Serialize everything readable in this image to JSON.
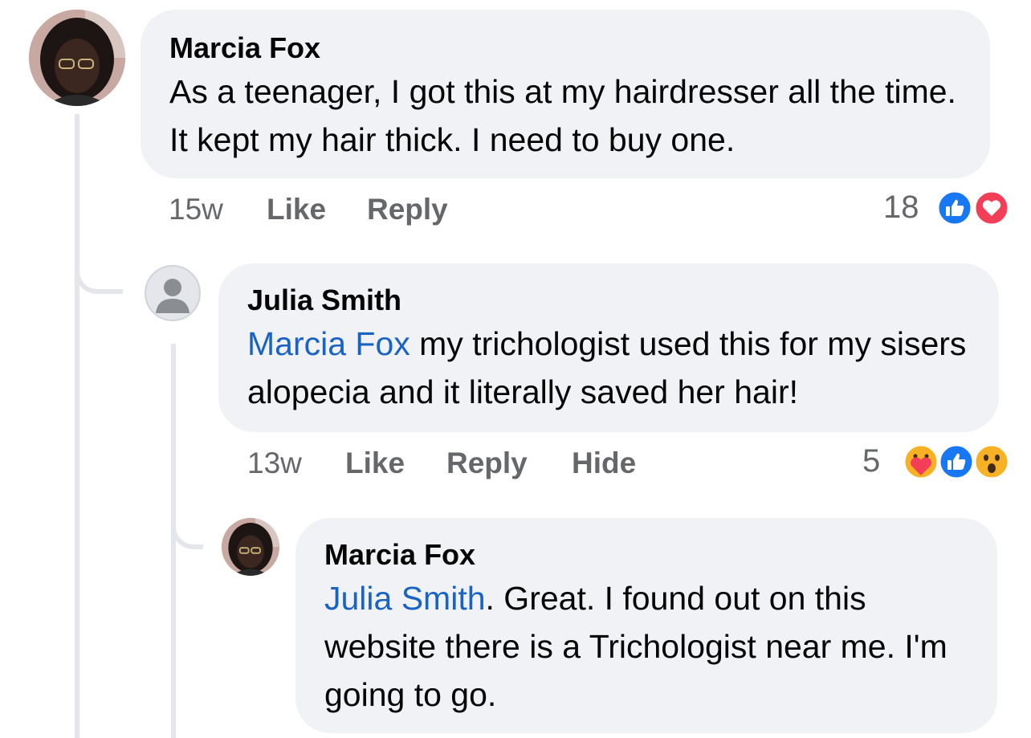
{
  "comments": [
    {
      "author": "Marcia Fox",
      "text": "As a teenager, I got this at my hairdresser all the time.  It kept my hair thick.  I need to buy one.",
      "time": "15w",
      "like_label": "Like",
      "reply_label": "Reply",
      "reaction_count": "18",
      "reactions": [
        "like-icon",
        "love-icon"
      ]
    },
    {
      "author": "Julia Smith",
      "mention": "Marcia Fox",
      "text": " my trichologist used this for my sisers alopecia and it literally saved her hair!",
      "time": "13w",
      "like_label": "Like",
      "reply_label": "Reply",
      "hide_label": "Hide",
      "reaction_count": "5",
      "reactions": [
        "care-icon",
        "like-icon",
        "wow-icon"
      ]
    },
    {
      "author": "Marcia Fox",
      "mention": "Julia Smith",
      "text": ". Great.  I found out on this website there is a Trichologist near me. I'm  going to go."
    }
  ],
  "colors": {
    "bubble": "#f0f2f5",
    "mention": "#1a63c6",
    "like": "#1877f2",
    "love": "#f33e58",
    "meta": "#65676b"
  }
}
